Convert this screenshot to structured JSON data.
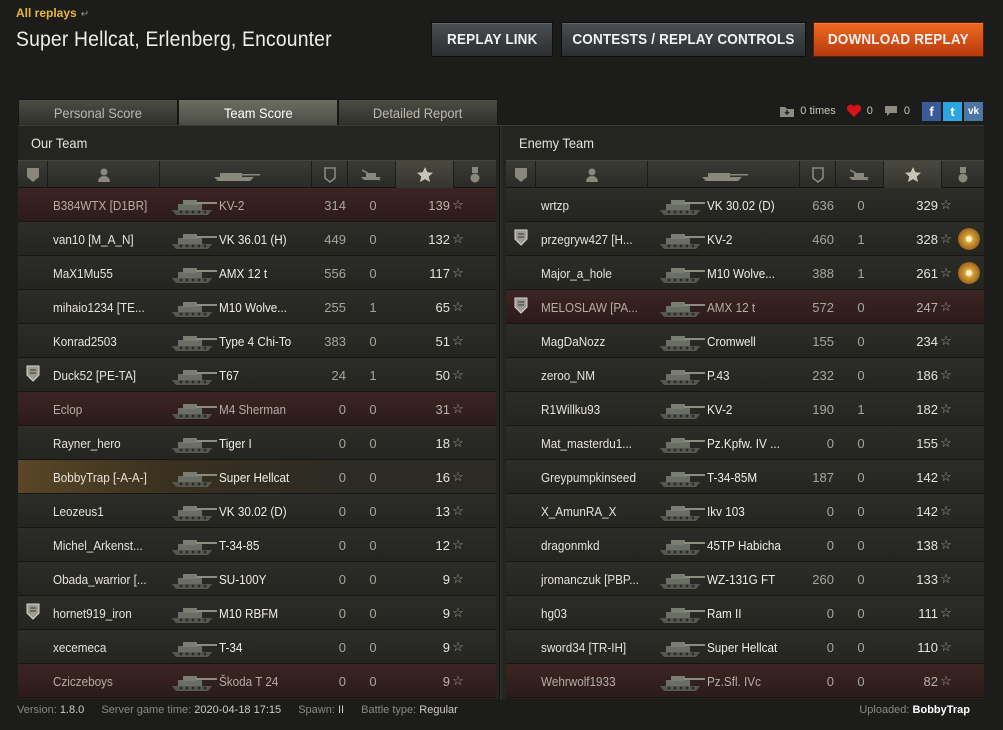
{
  "header": {
    "all_replays": "All replays",
    "title": "Super Hellcat, Erlenberg, Encounter",
    "buttons": {
      "replay_link": "REPLAY LINK",
      "contests": "CONTESTS / REPLAY CONTROLS",
      "download": "DOWNLOAD REPLAY"
    }
  },
  "tabs": [
    "Personal Score",
    "Team Score",
    "Detailed Report"
  ],
  "active_tab": "Team Score",
  "social": {
    "downloads": "0 times",
    "likes": "0",
    "comments": "0",
    "facebook": "f",
    "twitter": "t",
    "vk": "vk"
  },
  "teams": {
    "ours": {
      "title": "Our Team",
      "players": [
        {
          "name": "B384WTX [D1BR]",
          "tank": "KV-2",
          "damage": "314",
          "kills": "0",
          "xp": "139",
          "dead": true
        },
        {
          "name": "van10 [M_A_N]",
          "tank": "VK 36.01 (H)",
          "damage": "449",
          "kills": "0",
          "xp": "132"
        },
        {
          "name": "MaX1Mu55",
          "tank": "AMX 12 t",
          "damage": "556",
          "kills": "0",
          "xp": "117"
        },
        {
          "name": "mihaio1234 [TE...",
          "tank": "M10 Wolve...",
          "damage": "255",
          "kills": "1",
          "xp": "65"
        },
        {
          "name": "Konrad2503",
          "tank": "Type 4 Chi-To",
          "damage": "383",
          "kills": "0",
          "xp": "51"
        },
        {
          "name": "Duck52 [PE-TA]",
          "tank": "T67",
          "damage": "24",
          "kills": "1",
          "xp": "50",
          "badge": true
        },
        {
          "name": "Eclop",
          "tank": "M4 Sherman",
          "damage": "0",
          "kills": "0",
          "xp": "31",
          "dead": true
        },
        {
          "name": "Rayner_hero",
          "tank": "Tiger I",
          "damage": "0",
          "kills": "0",
          "xp": "18"
        },
        {
          "name": "BobbyTrap [-A-A-]",
          "tank": "Super Hellcat",
          "damage": "0",
          "kills": "0",
          "xp": "16",
          "me": true
        },
        {
          "name": "Leozeus1",
          "tank": "VK 30.02 (D)",
          "damage": "0",
          "kills": "0",
          "xp": "13"
        },
        {
          "name": "Michel_Arkenst...",
          "tank": "T-34-85",
          "damage": "0",
          "kills": "0",
          "xp": "12"
        },
        {
          "name": "Obada_warrior [...",
          "tank": "SU-100Y",
          "damage": "0",
          "kills": "0",
          "xp": "9"
        },
        {
          "name": "hornet919_iron",
          "tank": "M10 RBFM",
          "damage": "0",
          "kills": "0",
          "xp": "9",
          "badge": true
        },
        {
          "name": "xecemeca",
          "tank": "T-34",
          "damage": "0",
          "kills": "0",
          "xp": "9"
        },
        {
          "name": "Cziczeboys",
          "tank": "Škoda T 24",
          "damage": "0",
          "kills": "0",
          "xp": "9",
          "dead": true
        }
      ]
    },
    "enemy": {
      "title": "Enemy Team",
      "players": [
        {
          "name": "wrtzp",
          "tank": "VK 30.02 (D)",
          "damage": "636",
          "kills": "0",
          "xp": "329"
        },
        {
          "name": "przegryw427 [H...",
          "tank": "KV-2",
          "damage": "460",
          "kills": "1",
          "xp": "328",
          "badge": true,
          "medal": true
        },
        {
          "name": "Major_a_hole",
          "tank": "M10 Wolve...",
          "damage": "388",
          "kills": "1",
          "xp": "261",
          "medal": true
        },
        {
          "name": "MELOSLAW [PA...",
          "tank": "AMX 12 t",
          "damage": "572",
          "kills": "0",
          "xp": "247",
          "dead": true,
          "badge": true
        },
        {
          "name": "MagDaNozz",
          "tank": "Cromwell",
          "damage": "155",
          "kills": "0",
          "xp": "234"
        },
        {
          "name": "zeroo_NM",
          "tank": "P.43",
          "damage": "232",
          "kills": "0",
          "xp": "186"
        },
        {
          "name": "R1Willku93",
          "tank": "KV-2",
          "damage": "190",
          "kills": "1",
          "xp": "182"
        },
        {
          "name": "Mat_masterdu1...",
          "tank": "Pz.Kpfw. IV ...",
          "damage": "0",
          "kills": "0",
          "xp": "155"
        },
        {
          "name": "Greypumpkinseed",
          "tank": "T-34-85M",
          "damage": "187",
          "kills": "0",
          "xp": "142"
        },
        {
          "name": "X_AmunRA_X",
          "tank": "Ikv 103",
          "damage": "0",
          "kills": "0",
          "xp": "142"
        },
        {
          "name": "dragonmkd",
          "tank": "45TP Habicha",
          "damage": "0",
          "kills": "0",
          "xp": "138"
        },
        {
          "name": "jromanczuk [PBP...",
          "tank": "WZ-131G FT",
          "damage": "260",
          "kills": "0",
          "xp": "133"
        },
        {
          "name": "hg03",
          "tank": "Ram II",
          "damage": "0",
          "kills": "0",
          "xp": "111"
        },
        {
          "name": "sword34 [TR-IH]",
          "tank": "Super Hellcat",
          "damage": "0",
          "kills": "0",
          "xp": "110"
        },
        {
          "name": "Wehrwolf1933",
          "tank": "Pz.Sfl. IVc",
          "damage": "0",
          "kills": "0",
          "xp": "82",
          "dead": true
        }
      ]
    }
  },
  "footer": {
    "version_label": "Version:",
    "version": "1.8.0",
    "time_label": "Server game time:",
    "time": "2020-04-18 17:15",
    "spawn_label": "Spawn:",
    "spawn": "II",
    "battle_label": "Battle type:",
    "battle": "Regular",
    "uploaded_label": "Uploaded:",
    "uploaded": "BobbyTrap"
  },
  "colors": {
    "accent": "#e8b73a",
    "download_button": "#e05a1a",
    "dead_row": "#3a2222",
    "background": "#1c1c1a"
  }
}
